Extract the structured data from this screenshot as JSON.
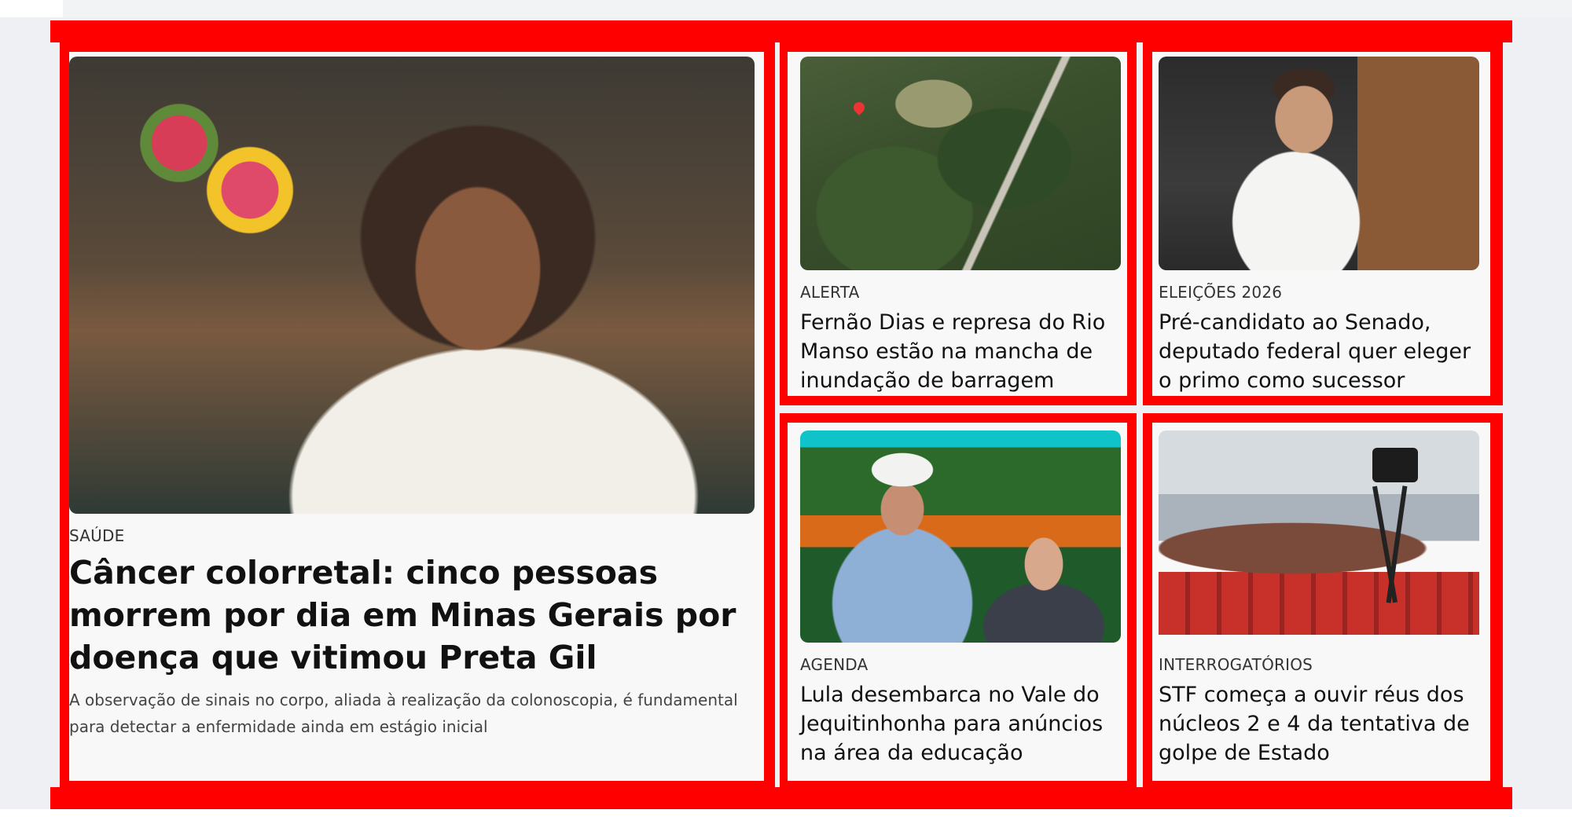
{
  "featured": {
    "category": "SAÚDE",
    "headline": "Câncer colorretal: cinco pessoas morrem por dia em Minas Gerais por doença que vitimou Preta Gil",
    "summary": "A observação de sinais no corpo, aliada à realização da colonoscopia, é fundamental para detectar a enfermidade ainda em estágio inicial",
    "image": "woman-portrait-photo"
  },
  "cards": [
    {
      "category": "ALERTA",
      "headline": "Fernão Dias e represa do Rio Manso estão na mancha de inundação de barragem",
      "image": "aerial-map-photo"
    },
    {
      "category": "ELEIÇÕES 2026",
      "headline": "Pré-candidato ao Senado, deputado federal quer eleger o primo como sucessor",
      "image": "speaker-podium-photo"
    },
    {
      "category": "AGENDA",
      "headline": "Lula desembarca no Vale do Jequitinhonha para anúncios na área da educação",
      "image": "lula-speech-photo"
    },
    {
      "category": "INTERROGATÓRIOS",
      "headline": "STF começa a ouvir réus dos núcleos 2 e 4 da tentativa de golpe de Estado",
      "image": "courtroom-photo"
    }
  ],
  "colors": {
    "highlight": "#ff0000",
    "card_bg": "#f8f8f9",
    "text": "#111111"
  }
}
